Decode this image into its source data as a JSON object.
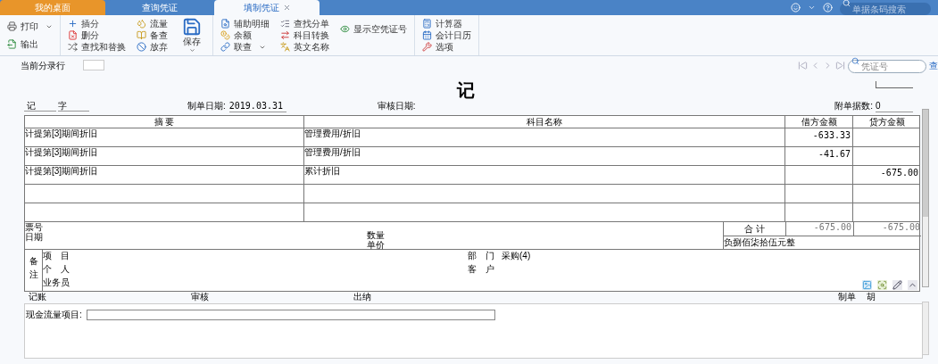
{
  "tabs": [
    {
      "label": "我的桌面",
      "kind": "home",
      "selected": false,
      "closable": false
    },
    {
      "label": "查询凭证",
      "kind": "page",
      "selected": false,
      "closable": false
    },
    {
      "label": "填制凭证",
      "kind": "page",
      "selected": true,
      "closable": true
    }
  ],
  "top_search": {
    "placeholder": "单据条码搜索"
  },
  "toolbar": [
    [
      [
        {
          "label": "打印",
          "dropdown": true
        },
        {
          "label": "输出",
          "dropdown": false
        }
      ]
    ],
    [
      [
        {
          "label": "插分",
          "dropdown": false
        },
        {
          "label": "删分",
          "dropdown": false
        },
        {
          "label": "查找和替换",
          "dropdown": false
        }
      ],
      [
        {
          "label": "流量",
          "dropdown": false
        },
        {
          "label": "备查",
          "dropdown": false
        },
        {
          "label": "放弃",
          "dropdown": false
        }
      ],
      [
        {
          "label": "保存",
          "dropdown": true,
          "kind": "large"
        }
      ]
    ],
    [
      [
        {
          "label": "辅助明细",
          "dropdown": false
        },
        {
          "label": "余额",
          "dropdown": false
        },
        {
          "label": "联查",
          "dropdown": true
        }
      ],
      [
        {
          "label": "查找分单",
          "dropdown": false
        },
        {
          "label": "科目转换",
          "dropdown": false
        },
        {
          "label": "英文名称",
          "dropdown": false
        }
      ],
      [
        {
          "label": "显示空凭证号",
          "dropdown": false
        }
      ]
    ],
    [
      [
        {
          "label": "计算器",
          "dropdown": false
        },
        {
          "label": "会计日历",
          "dropdown": false
        },
        {
          "label": "选项",
          "dropdown": false
        }
      ]
    ]
  ],
  "entry_row": {
    "label": "当前分录行"
  },
  "voucher_search": {
    "placeholder": "凭证号",
    "link": "查"
  },
  "voucher": {
    "title": "记",
    "type_label": "记",
    "number_label": "字",
    "date_label": "制单日期:",
    "date": "2019.03.31",
    "audit_date_label": "审核日期:",
    "attachments_label": "附单据数:",
    "attachments": "0"
  },
  "table": {
    "columns": [
      "摘 要",
      "科目名称",
      "借方金额",
      "贷方金额"
    ],
    "rows": [
      {
        "summary": "计提第[3]期间折旧",
        "account": "管理费用/折旧",
        "debit": "-633.33",
        "credit": ""
      },
      {
        "summary": "计提第[3]期间折旧",
        "account": "管理费用/折旧",
        "debit": "-41.67",
        "credit": ""
      },
      {
        "summary": "计提第[3]期间折旧",
        "account": "累计折旧",
        "debit": "",
        "credit": "-675.00"
      },
      {
        "summary": "",
        "account": "",
        "debit": "",
        "credit": ""
      },
      {
        "summary": "",
        "account": "",
        "debit": "",
        "credit": ""
      }
    ]
  },
  "totals": {
    "ticket_label": "票号",
    "date_label": "日期",
    "quantity_label": "数量",
    "price_label": "单价",
    "total_label": "合 计",
    "debit_total": "-675.00",
    "credit_total": "-675.00",
    "amount_words": "负捌佰柒拾伍元整"
  },
  "notes": {
    "label": "备注",
    "project_label": "项　目",
    "department_label": "部　门",
    "department": "采购(4)",
    "person_label": "个　人",
    "customer_label": "客　户",
    "salesperson_label": "业务员"
  },
  "signatures": {
    "posted_label": "记账",
    "reviewed_label": "审核",
    "cashier_label": "出纳",
    "preparer_label": "制单",
    "preparer": "胡"
  },
  "cash_flow": {
    "label": "现金流量项目:"
  }
}
